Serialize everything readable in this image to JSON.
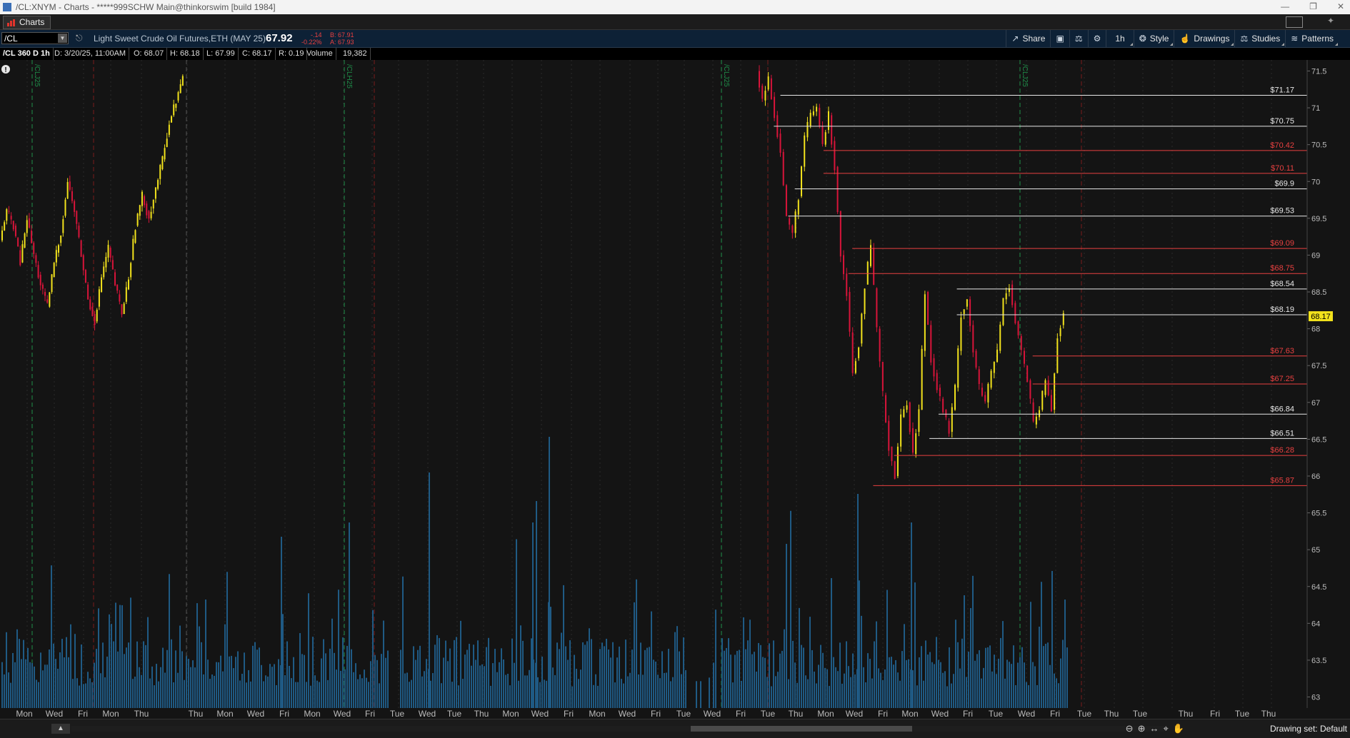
{
  "window": {
    "title": "/CL:XNYM - Charts - *****999SCHW Main@thinkorswim [build 1984]",
    "controls": [
      "—",
      "❐",
      "✕"
    ]
  },
  "tab": {
    "label": "Charts"
  },
  "toolbar": {
    "symbol": "/CL",
    "description": "Light Sweet Crude Oil Futures,ETH (MAY 25)",
    "last": "67.92",
    "net_change": "-.14",
    "pct_change": "-0.22%",
    "bid": "B: 67.91",
    "ask": "A: 67.93",
    "buttons": {
      "share": "Share",
      "timeframe": "1h",
      "style": "Style",
      "drawings": "Drawings",
      "studies": "Studies",
      "patterns": "Patterns"
    }
  },
  "info": {
    "symbol_tf": "/CL 360 D 1h",
    "date": "D: 3/20/25, 11:00AM",
    "open": "O: 68.07",
    "high": "H: 68.18",
    "low": "L: 67.99",
    "close": "C: 68.17",
    "range": "R: 0.19",
    "volume_label": "Volume",
    "volume_value": "19,382"
  },
  "colors": {
    "up_candle": "#f2e21c",
    "down_candle": "#d8143a",
    "volume": "#1f5a84",
    "level_white": "#e8e8e8",
    "level_red": "#e84040",
    "current_price_bg": "#f2e21c",
    "contract_marker": "#1f8f4a"
  },
  "chart_data": {
    "type": "candlestick",
    "timeframe": "1h",
    "price_axis": {
      "ylim": [
        62.85,
        71.65
      ],
      "ticks": [
        71.5,
        71,
        70.5,
        70,
        69.5,
        69,
        68.5,
        68,
        67.5,
        67,
        66.5,
        66,
        65.5,
        65,
        64.5,
        64,
        63.5,
        63
      ]
    },
    "current_price": "68.17",
    "levels": [
      {
        "price": 71.17,
        "label": "$71.17",
        "color": "white",
        "from_x": 0.597
      },
      {
        "price": 70.75,
        "label": "$70.75",
        "color": "white",
        "from_x": 0.592
      },
      {
        "price": 70.42,
        "label": "$70.42",
        "color": "red",
        "from_x": 0.63
      },
      {
        "price": 70.11,
        "label": "$70.11",
        "color": "red",
        "from_x": 0.63
      },
      {
        "price": 69.9,
        "label": "$69.9",
        "color": "white",
        "from_x": 0.608
      },
      {
        "price": 69.53,
        "label": "$69.53",
        "color": "white",
        "from_x": 0.603
      },
      {
        "price": 69.09,
        "label": "$69.09",
        "color": "red",
        "from_x": 0.652
      },
      {
        "price": 68.75,
        "label": "$68.75",
        "color": "red",
        "from_x": 0.649
      },
      {
        "price": 68.54,
        "label": "$68.54",
        "color": "white",
        "from_x": 0.732
      },
      {
        "price": 68.19,
        "label": "$68.19",
        "color": "white",
        "from_x": 0.732
      },
      {
        "price": 67.63,
        "label": "$67.63",
        "color": "red",
        "from_x": 0.79
      },
      {
        "price": 67.25,
        "label": "$67.25",
        "color": "red",
        "from_x": 0.79
      },
      {
        "price": 66.84,
        "label": "$66.84",
        "color": "white",
        "from_x": 0.718
      },
      {
        "price": 66.51,
        "label": "$66.51",
        "color": "white",
        "from_x": 0.711
      },
      {
        "price": 66.28,
        "label": "$66.28",
        "color": "red",
        "from_x": 0.684
      },
      {
        "price": 65.87,
        "label": "$65.87",
        "color": "red",
        "from_x": 0.668
      }
    ],
    "day_labels": [
      "Mon",
      "Wed",
      "Fri",
      "Mon",
      "Thu",
      "Thu",
      "Mon",
      "Wed",
      "Fri",
      "Mon",
      "Wed",
      "Fri",
      "Tue",
      "Wed",
      "Tue",
      "Thu",
      "Mon",
      "Wed",
      "Fri",
      "Mon",
      "Wed",
      "Fri",
      "Tue",
      "Wed",
      "Fri",
      "Tue",
      "Thu",
      "Mon",
      "Wed",
      "Fri",
      "Mon",
      "Wed",
      "Fri",
      "Tue",
      "Wed",
      "Fri",
      "Tue",
      "Thu",
      "Tue",
      "Thu",
      "Fri",
      "Tue",
      "Thu"
    ],
    "contract_markers": [
      "/CLJ25",
      "/CLH25",
      "/CLJ25",
      "/CLJ25"
    ],
    "segments": [
      {
        "start": 0.0,
        "end": 0.0,
        "prices": [
          69.2,
          69.6,
          69.4,
          68.9,
          69.5,
          69.0,
          68.6,
          68.3,
          68.9,
          69.3,
          70.0,
          69.6,
          69.0,
          68.4,
          68.1,
          68.7,
          69.1,
          68.6,
          68.2,
          68.7,
          69.4,
          69.8,
          69.5,
          69.9,
          70.3,
          70.8,
          71.1,
          71.4
        ]
      },
      {
        "start": 0.0,
        "end": 0.0,
        "prices": [
          71.5,
          71.1,
          71.4,
          70.9,
          70.4,
          69.5,
          69.3,
          69.8,
          70.6,
          70.9,
          71.0,
          70.5,
          70.9,
          70.2,
          69.0,
          68.5,
          67.4,
          67.8,
          68.6,
          69.1,
          68.0,
          67.1,
          66.4,
          66.0,
          66.8,
          67.0,
          66.3,
          66.9,
          68.5,
          67.6,
          67.2,
          66.9,
          66.6,
          67.2,
          68.2,
          68.4,
          67.7,
          67.2,
          67.0,
          67.4,
          67.7,
          68.4,
          68.6,
          68.1,
          67.7,
          67.3,
          66.7,
          66.9,
          67.3,
          66.9,
          67.9,
          68.2
        ]
      }
    ],
    "volume_axis": {
      "ylim": [
        0,
        1
      ]
    },
    "future_day_labels_note": ""
  },
  "bottom": {
    "collapse": "▲",
    "drawing_set": "Drawing set: Default"
  }
}
